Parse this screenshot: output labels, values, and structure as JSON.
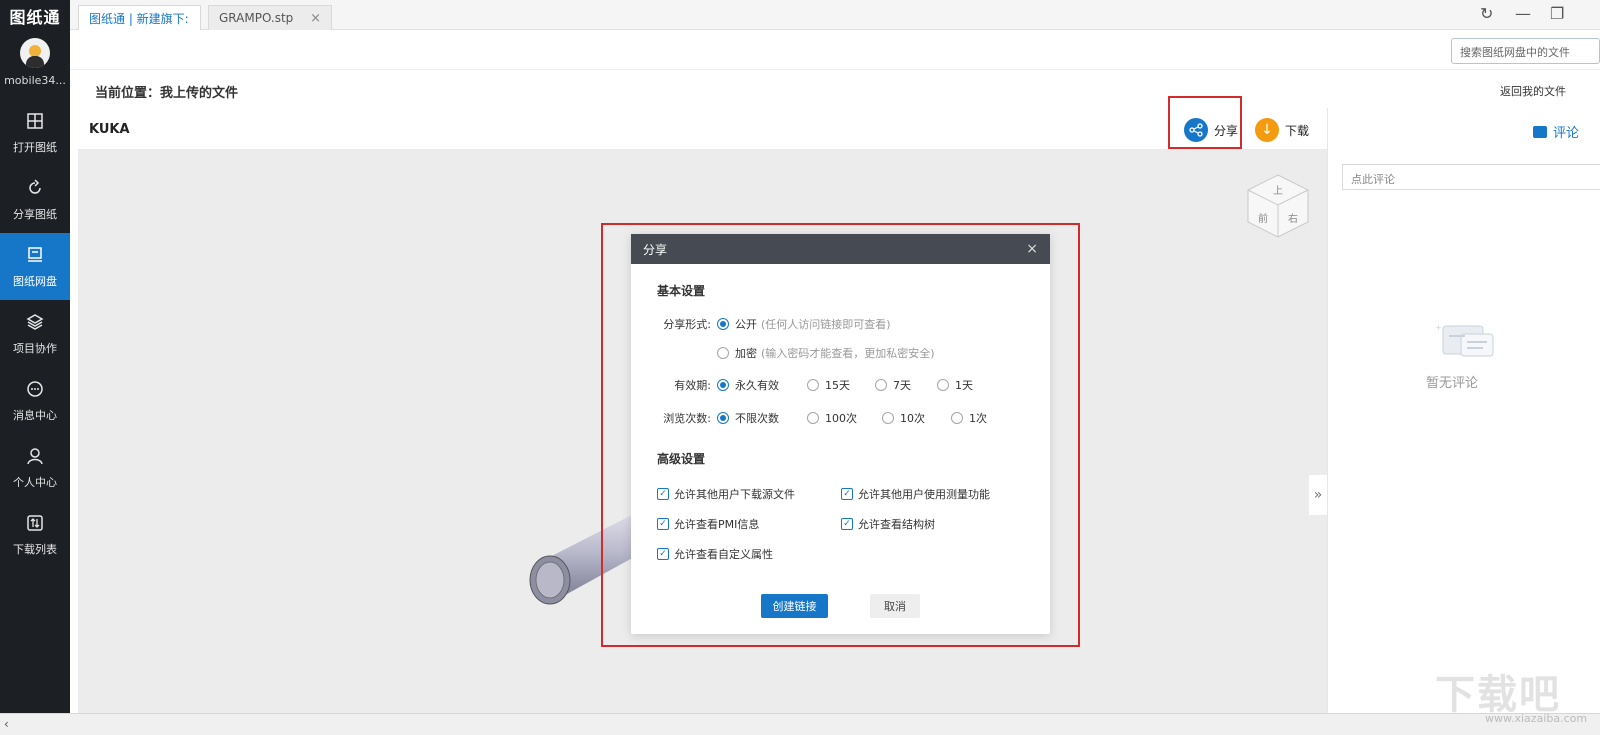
{
  "app": {
    "logo_text": "图纸通",
    "username": "mobile34..."
  },
  "sidebar": {
    "items": [
      {
        "label": "打开图纸",
        "icon": "open-drawing-icon"
      },
      {
        "label": "分享图纸",
        "icon": "share-drawing-icon"
      },
      {
        "label": "图纸网盘",
        "icon": "cloud-drive-icon",
        "active": true
      },
      {
        "label": "项目协作",
        "icon": "layers-icon"
      },
      {
        "label": "消息中心",
        "icon": "message-icon"
      },
      {
        "label": "个人中心",
        "icon": "user-icon"
      },
      {
        "label": "下载列表",
        "icon": "download-list-icon"
      }
    ]
  },
  "tabs": [
    {
      "label": "图纸通 | 新建旗下:",
      "active": true
    },
    {
      "label": "GRAMPO.stp",
      "close": "×",
      "active": false
    }
  ],
  "window_controls": {
    "refresh": "↻",
    "minimize": "—",
    "restore": "❐"
  },
  "search": {
    "placeholder": "搜索图纸网盘中的文件"
  },
  "location": {
    "text": "当前位置：我上传的文件",
    "back": "返回我的文件"
  },
  "viewer": {
    "file_title": "KUKA",
    "share_label": "分享",
    "download_label": "下载",
    "cube_labels": {
      "top": "上",
      "front": "前",
      "right": "右"
    },
    "collapse": "»"
  },
  "comments": {
    "title": "评论",
    "input_placeholder": "点此评论",
    "empty_text": "暂无评论"
  },
  "modal": {
    "title": "分享",
    "close": "×",
    "basic_settings": "基本设置",
    "share_form": {
      "label": "分享形式:",
      "options": [
        {
          "label": "公开",
          "hint": "(任何人访问链接即可查看)",
          "selected": true
        },
        {
          "label": "加密",
          "hint": "(输入密码才能查看，更加私密安全)",
          "selected": false
        }
      ]
    },
    "validity": {
      "label": "有效期:",
      "options": [
        {
          "label": "永久有效",
          "selected": true
        },
        {
          "label": "15天",
          "selected": false
        },
        {
          "label": "7天",
          "selected": false
        },
        {
          "label": "1天",
          "selected": false
        }
      ]
    },
    "views": {
      "label": "浏览次数:",
      "options": [
        {
          "label": "不限次数",
          "selected": true
        },
        {
          "label": "100次",
          "selected": false
        },
        {
          "label": "10次",
          "selected": false
        },
        {
          "label": "1次",
          "selected": false
        }
      ]
    },
    "advanced_settings": "高级设置",
    "checks": [
      {
        "label": "允许其他用户下载源文件",
        "checked": true
      },
      {
        "label": "允许其他用户使用测量功能",
        "checked": true
      },
      {
        "label": "允许查看PMI信息",
        "checked": true
      },
      {
        "label": "允许查看结构树",
        "checked": true
      },
      {
        "label": "允许查看自定义属性",
        "checked": true
      }
    ],
    "create_button": "创建链接",
    "cancel_button": "取消"
  },
  "watermark": {
    "main": "下载吧",
    "sub": "www.xiazaiba.com"
  },
  "colors": {
    "sidebar_bg": "#1c1f24",
    "accent": "#1677c8",
    "highlight": "#d32b2b",
    "download": "#f39c12"
  }
}
